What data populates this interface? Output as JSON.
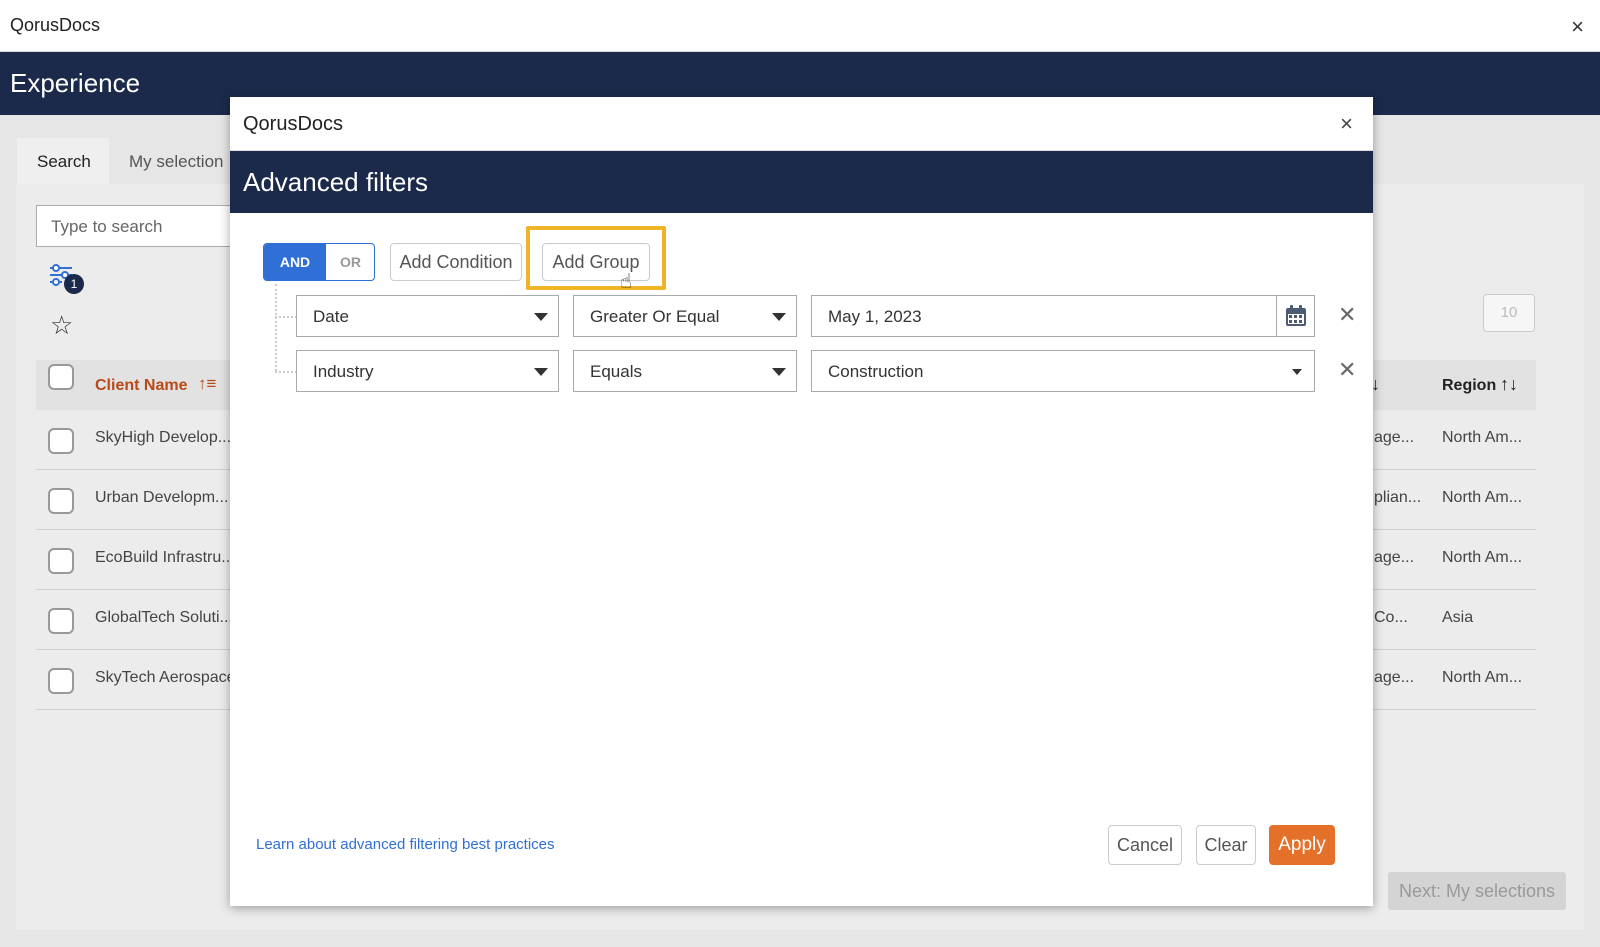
{
  "window": {
    "title": "QorusDocs",
    "close_symbol": "×"
  },
  "app": {
    "header_title": "Experience"
  },
  "background": {
    "tabs": [
      {
        "label": "Search"
      },
      {
        "label": "My selection"
      }
    ],
    "search": {
      "placeholder": "Type to search"
    },
    "filter_badge": "1",
    "pager_value": "10",
    "table": {
      "headers": {
        "client_name": "Client Name",
        "region": "Region"
      },
      "rows": [
        {
          "name": "SkyHigh Develop...",
          "mid": "age...",
          "region": "North Am..."
        },
        {
          "name": "Urban Developm...",
          "mid": "plian...",
          "region": "North Am..."
        },
        {
          "name": "EcoBuild Infrastru...",
          "mid": "age...",
          "region": "North Am..."
        },
        {
          "name": "GlobalTech Soluti...",
          "mid": "Co...",
          "region": "Asia"
        },
        {
          "name": "SkyTech Aerospace",
          "mid": "age...",
          "region": "North Am..."
        }
      ]
    },
    "next_button": "Next: My selections"
  },
  "modal": {
    "title": "QorusDocs",
    "close_symbol": "×",
    "header": "Advanced filters",
    "toggle": {
      "and": "AND",
      "or": "OR",
      "selected": "AND"
    },
    "buttons": {
      "add_condition": "Add Condition",
      "add_group": "Add Group"
    },
    "conditions": [
      {
        "field": "Date",
        "operator": "Greater Or Equal",
        "value": "May 1, 2023"
      },
      {
        "field": "Industry",
        "operator": "Equals",
        "value": "Construction"
      }
    ],
    "remove_symbol": "✕",
    "learn_link": "Learn about advanced filtering best practices",
    "footer": {
      "cancel": "Cancel",
      "clear": "Clear",
      "apply": "Apply"
    }
  },
  "colors": {
    "navy": "#1b2a4a",
    "primary_blue": "#2f6fd6",
    "apply_orange": "#e5702a",
    "highlight": "#f0b429"
  }
}
